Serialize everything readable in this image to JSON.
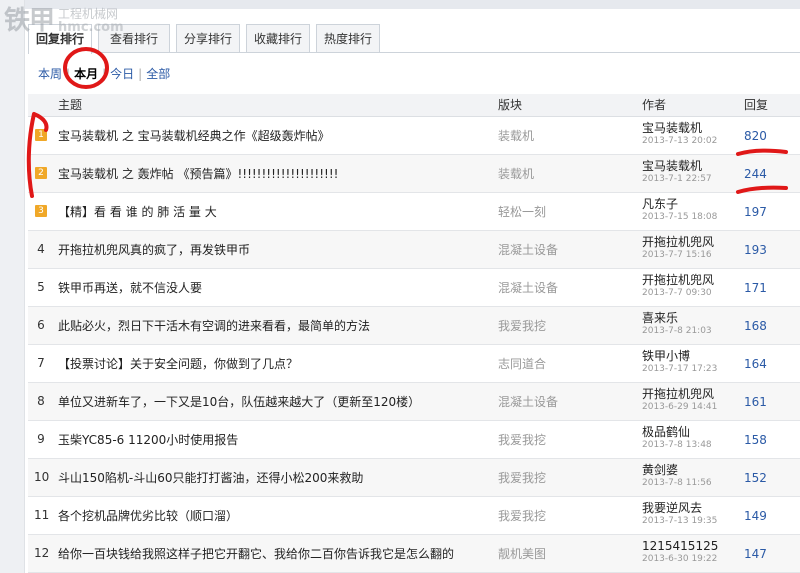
{
  "watermark": {
    "logo": "铁甲",
    "sub": "工程机械网",
    "url": "hmc.com"
  },
  "tabs": [
    "回复排行",
    "查看排行",
    "分享排行",
    "收藏排行",
    "热度排行"
  ],
  "filters": [
    "本周",
    "本月",
    "今日",
    "全部"
  ],
  "headers": {
    "title": "主题",
    "forum": "版块",
    "author": "作者",
    "reply": "回复"
  },
  "rows": [
    {
      "rank": "1",
      "title": "宝马装载机 之 宝马装载机经典之作《超级轰炸帖》",
      "forum": "装载机",
      "author": "宝马装载机",
      "date": "2013-7-13 20:02",
      "replies": "820"
    },
    {
      "rank": "2",
      "title": "宝马装载机 之 轰炸帖 《预告篇》!!!!!!!!!!!!!!!!!!!!!",
      "forum": "装载机",
      "author": "宝马装载机",
      "date": "2013-7-1 22:57",
      "replies": "244"
    },
    {
      "rank": "3",
      "title": "【精】看 看 谁 的 肺 活 量 大",
      "forum": "轻松一刻",
      "author": "凡东子",
      "date": "2013-7-15 18:08",
      "replies": "197"
    },
    {
      "rank": "4",
      "title": "开拖拉机兜风真的疯了，再发铁甲币",
      "forum": "混凝土设备",
      "author": "开拖拉机兜风",
      "date": "2013-7-7 15:16",
      "replies": "193"
    },
    {
      "rank": "5",
      "title": "铁甲币再送，就不信没人要",
      "forum": "混凝土设备",
      "author": "开拖拉机兜风",
      "date": "2013-7-7 09:30",
      "replies": "171"
    },
    {
      "rank": "6",
      "title": "此贴必火，烈日下干活木有空调的进来看看，最简单的方法",
      "forum": "我爱我挖",
      "author": "喜来乐",
      "date": "2013-7-8 21:03",
      "replies": "168"
    },
    {
      "rank": "7",
      "title": "【投票讨论】关于安全问题，你做到了几点？",
      "forum": "志同道合",
      "author": "铁甲小博",
      "date": "2013-7-17 17:23",
      "replies": "164"
    },
    {
      "rank": "8",
      "title": "单位又进新车了，一下又是10台，队伍越来越大了（更新至120楼）",
      "forum": "混凝土设备",
      "author": "开拖拉机兜风",
      "date": "2013-6-29 14:41",
      "replies": "161"
    },
    {
      "rank": "9",
      "title": "玉柴YC85-6 11200小时使用报告",
      "forum": "我爱我挖",
      "author": "极品鹤仙",
      "date": "2013-7-8 13:48",
      "replies": "158"
    },
    {
      "rank": "10",
      "title": "斗山150陷机-斗山60只能打打酱油，还得小松200来救助",
      "forum": "我爱我挖",
      "author": "黄剑婆",
      "date": "2013-7-8 11:56",
      "replies": "152"
    },
    {
      "rank": "11",
      "title": "各个挖机品牌优劣比较（顺口溜）",
      "forum": "我爱我挖",
      "author": "我要逆风去",
      "date": "2013-7-13 19:35",
      "replies": "149"
    },
    {
      "rank": "12",
      "title": "给你一百块钱给我照这样子把它开翻它、我给你二百你告诉我它是怎么翻的",
      "forum": "靓机美图",
      "author": "1215415125",
      "date": "2013-6-30 19:22",
      "replies": "147"
    }
  ],
  "colors": {
    "link": "#2b5aa6",
    "muted": "#999999",
    "badge": "#f0a828",
    "annotation": "#e01818"
  }
}
